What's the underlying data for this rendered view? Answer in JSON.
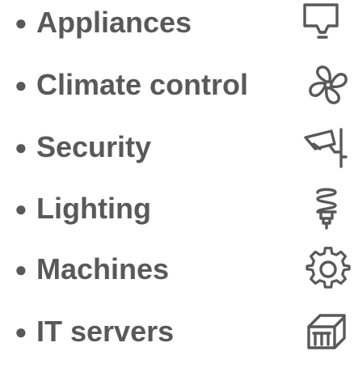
{
  "items": [
    {
      "label": "Appliances",
      "icon": "appliance-display-icon"
    },
    {
      "label": "Climate control",
      "icon": "fan-icon"
    },
    {
      "label": "Security",
      "icon": "security-camera-icon"
    },
    {
      "label": "Lighting",
      "icon": "light-bulb-icon"
    },
    {
      "label": "Machines",
      "icon": "gear-icon"
    },
    {
      "label": "IT servers",
      "icon": "server-rack-icon"
    }
  ],
  "bullet_glyph": "●",
  "colors": {
    "text": "#595959",
    "icon": "#595959",
    "background": "#ffffff"
  }
}
